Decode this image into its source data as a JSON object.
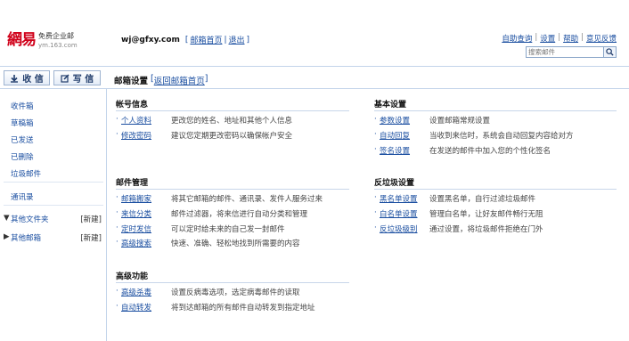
{
  "header": {
    "logo_mark": "網易",
    "logo_sub1": "免费企业邮",
    "logo_sub2": "ym.163.com",
    "account_addr": "wj@gfxy.com",
    "bracket_open": "[",
    "account_home": "邮箱首页",
    "separator": "|",
    "account_logout": "退出",
    "bracket_close": "]",
    "toplinks": [
      "自助查询",
      "设置",
      "帮助",
      "意见反馈"
    ],
    "search_placeholder": "搜索邮件"
  },
  "toolbar": {
    "receive_label": "收 信",
    "write_label": "写 信",
    "page_title": "邮箱设置",
    "bracket_open": "[",
    "back_link": "返回邮箱首页",
    "bracket_close": "]"
  },
  "sidebar": {
    "items": [
      "收件箱",
      "草稿箱",
      "已发送",
      "已删除",
      "垃圾邮件"
    ],
    "contacts": "通讯录",
    "folders": {
      "arrow": "▼",
      "label": "其他文件夹",
      "new": "[新建]"
    },
    "other_mail": {
      "arrow": "▶",
      "label": "其他邮箱",
      "new": "[新建]"
    }
  },
  "sections": {
    "account": {
      "title": "帐号信息",
      "items": [
        {
          "link": "个人资料",
          "desc": "更改您的姓名、地址和其他个人信息"
        },
        {
          "link": "修改密码",
          "desc": "建议您定期更改密码以确保帐户安全"
        }
      ]
    },
    "mail": {
      "title": "邮件管理",
      "items": [
        {
          "link": "邮箱搬家",
          "desc": "将其它邮箱的邮件、通讯录、发件人服务过来"
        },
        {
          "link": "来信分类",
          "desc": "邮件过滤器，将来信进行自动分类和管理"
        },
        {
          "link": "定时发信",
          "desc": "可以定时给未来的自己发一封邮件"
        },
        {
          "link": "高级搜索",
          "desc": "快速、准确、轻松地找到所需要的内容"
        }
      ]
    },
    "advanced": {
      "title": "高级功能",
      "items": [
        {
          "link": "高级杀毒",
          "desc": "设置反病毒选项，选定病毒邮件的读取"
        },
        {
          "link": "自动转发",
          "desc": "将到达邮箱的所有邮件自动转发到指定地址"
        }
      ]
    },
    "basic": {
      "title": "基本设置",
      "items": [
        {
          "link": "参数设置",
          "desc": "设置邮箱常规设置"
        },
        {
          "link": "自动回复",
          "desc": "当收到来信时，系统会自动回复内容给对方"
        },
        {
          "link": "签名设置",
          "desc": "在发送的邮件中加入您的个性化签名"
        }
      ]
    },
    "spam": {
      "title": "反垃圾设置",
      "items": [
        {
          "link": "黑名单设置",
          "desc": "设置黑名单，自行过滤垃圾邮件"
        },
        {
          "link": "白名单设置",
          "desc": "管理白名单，让好友邮件畅行无阻"
        },
        {
          "link": "反垃圾级别",
          "desc": "通过设置，将垃圾邮件拒绝在门外"
        }
      ]
    },
    "bullet": "·"
  },
  "colors": {
    "link": "#1a4ea0",
    "brand": "#d0021b",
    "border": "#c3d4ea"
  }
}
